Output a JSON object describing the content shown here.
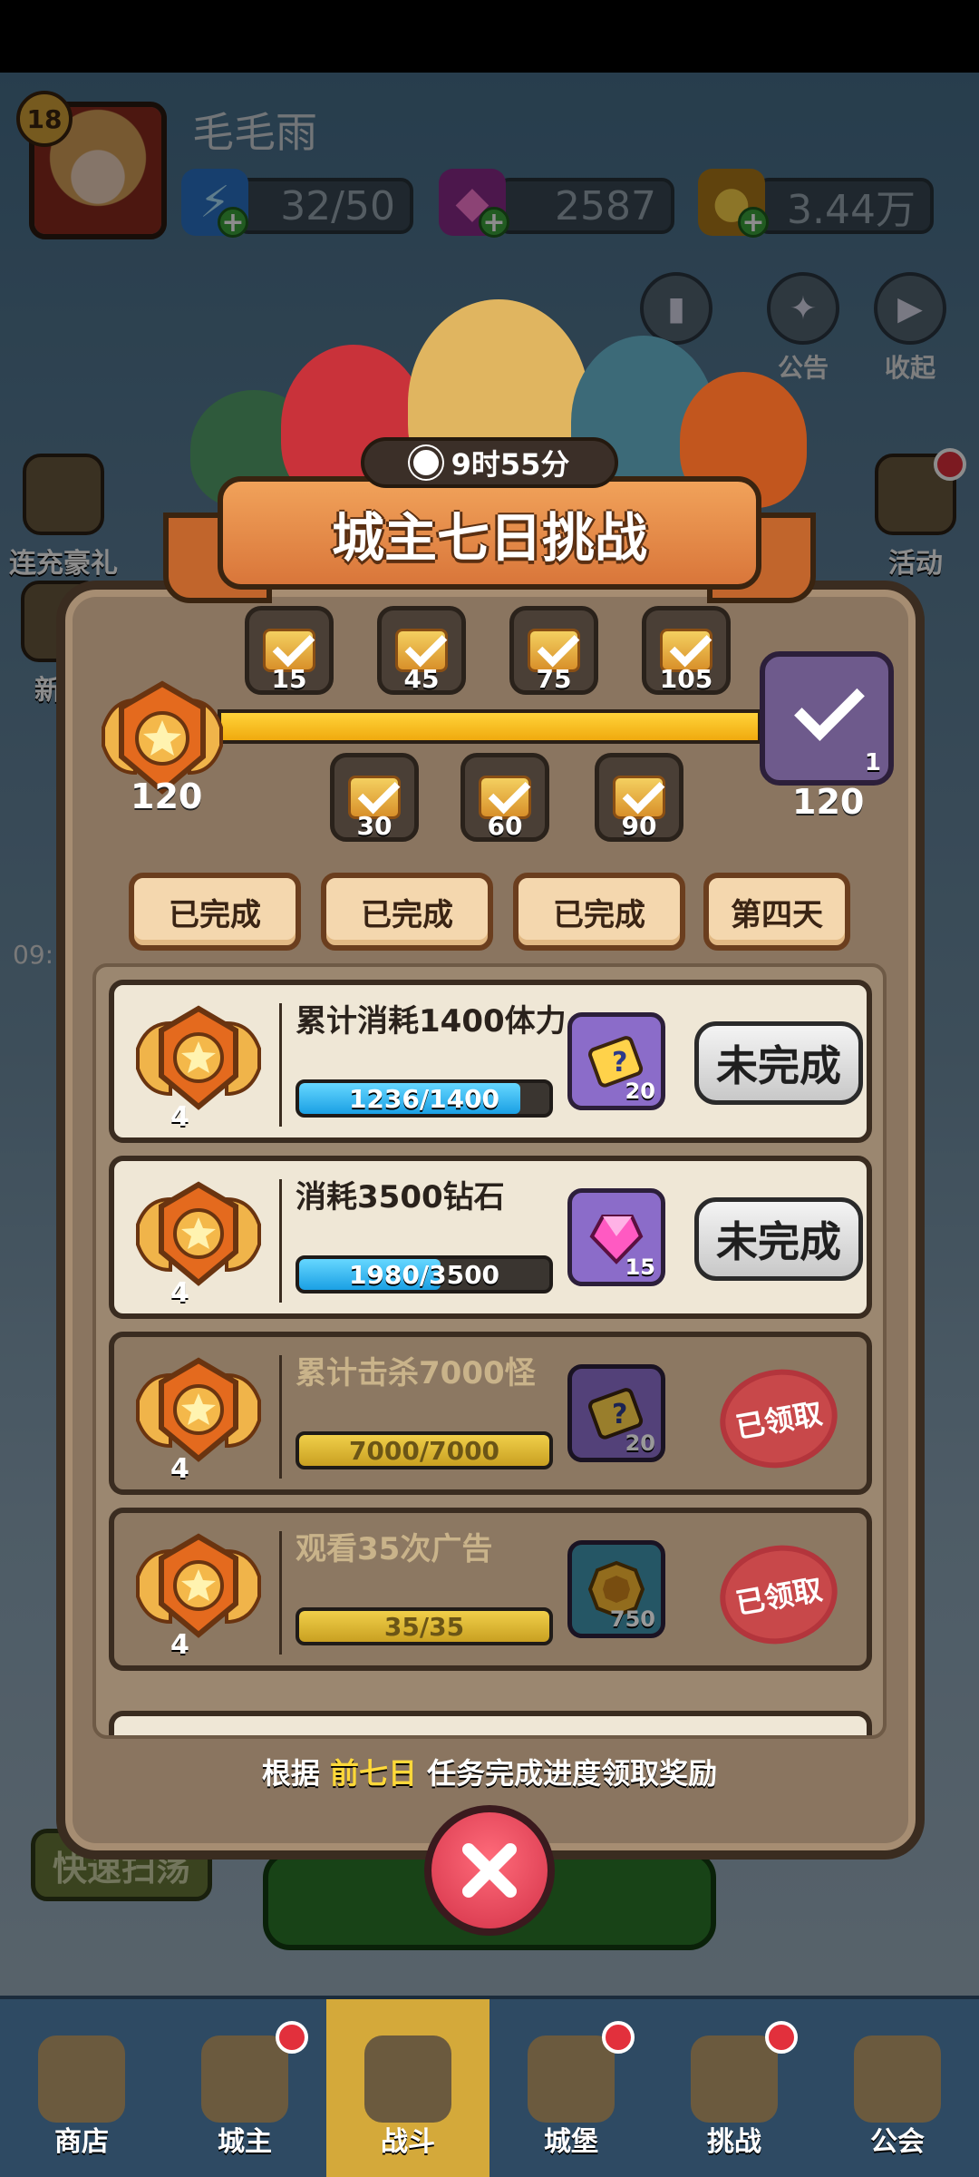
{
  "player": {
    "level": "18",
    "name": "毛毛雨"
  },
  "resources": [
    {
      "name": "energy",
      "value": "32/50",
      "icon": "lightning-icon"
    },
    {
      "name": "diamond",
      "value": "2587",
      "icon": "gem-icon"
    },
    {
      "name": "gold",
      "value": "3.44万",
      "icon": "coin-icon"
    }
  ],
  "top_icons": [
    "榜",
    "公告",
    "收起"
  ],
  "side_left": [
    "连充豪礼",
    "新人"
  ],
  "side_right": [
    "活动"
  ],
  "side_left_time": "09:",
  "modal": {
    "timer": "9时55分",
    "title": "城主七日挑战",
    "progress": {
      "current": 120,
      "max": 120,
      "left_value": "120",
      "right_value": "120",
      "final_count": "1"
    },
    "milestones_top": [
      "15",
      "45",
      "75",
      "105"
    ],
    "milestones_bottom": [
      "30",
      "60",
      "90"
    ],
    "day_tabs": [
      "已完成",
      "已完成",
      "已完成",
      "第四天"
    ],
    "tasks": [
      {
        "title": "累计消耗1400体力",
        "medal": "4",
        "progress_text": "1236/1400",
        "progress": 0.883,
        "reward": "puzzle-icon",
        "reward_count": "20",
        "status": "未完成",
        "done": false
      },
      {
        "title": "消耗3500钻石",
        "medal": "4",
        "progress_text": "1980/3500",
        "progress": 0.566,
        "reward": "gem-icon",
        "reward_count": "15",
        "status": "未完成",
        "done": false
      },
      {
        "title": "累计击杀7000怪",
        "medal": "4",
        "progress_text": "7000/7000",
        "progress": 1.0,
        "reward": "puzzle-icon",
        "reward_count": "20",
        "status": "已领取",
        "done": true
      },
      {
        "title": "观看35次广告",
        "medal": "4",
        "progress_text": "35/35",
        "progress": 1.0,
        "reward": "coin-icon",
        "reward_count": "750",
        "status": "已领取",
        "done": true
      }
    ],
    "hint_prefix": "根据",
    "hint_highlight": "前七日",
    "hint_suffix": "任务完成进度领取奖励"
  },
  "quick_sweep": "快速扫荡",
  "bottom_nav": [
    "商店",
    "城主",
    "战斗",
    "城堡",
    "挑战",
    "公会"
  ],
  "colors": {
    "accent_gold": "#f0aa0e",
    "progress_blue": "#1aa0e4",
    "stamp_red": "#b3353c",
    "close_red": "#d33248"
  }
}
